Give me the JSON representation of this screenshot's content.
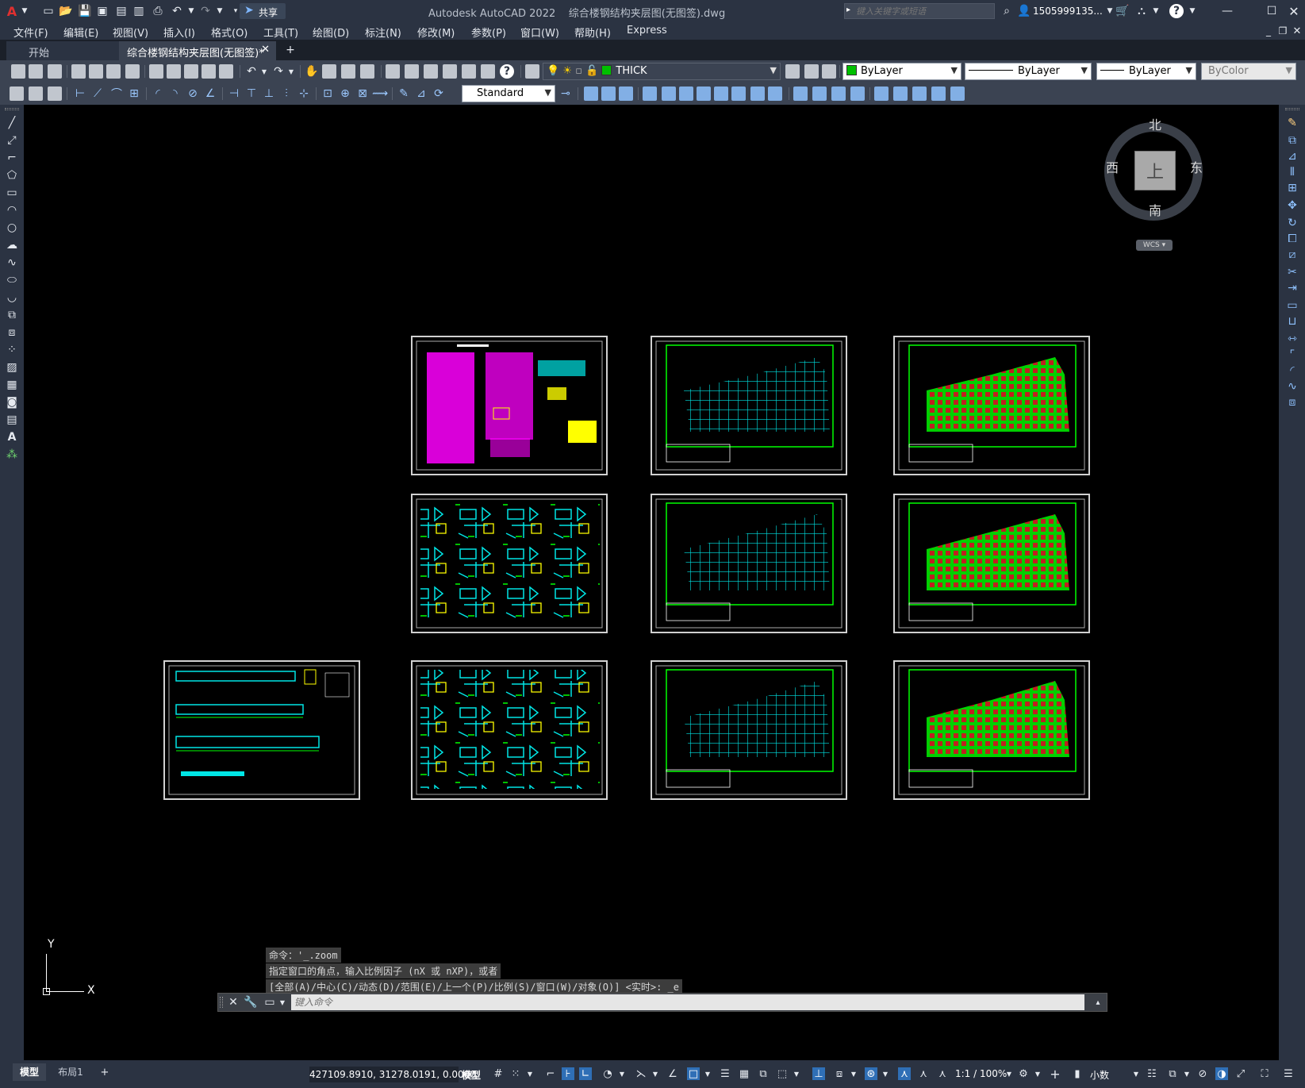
{
  "window": {
    "title": "Autodesk AutoCAD 2022",
    "document": "综合楼钢结构夹层图(无图签).dwg",
    "search_placeholder": "键入关键字或短语",
    "user": "1505999135..."
  },
  "quick_access": {
    "share_label": "共享"
  },
  "menu": [
    "文件(F)",
    "编辑(E)",
    "视图(V)",
    "插入(I)",
    "格式(O)",
    "工具(T)",
    "绘图(D)",
    "标注(N)",
    "修改(M)",
    "参数(P)",
    "窗口(W)",
    "帮助(H)",
    "Express"
  ],
  "tabs": {
    "start": "开始",
    "active": "综合楼钢结构夹层图(无图签)*"
  },
  "properties": {
    "layer": "THICK",
    "layer_color": "#00c000",
    "color": "ByLayer",
    "linetype": "ByLayer",
    "lineweight": "ByLayer",
    "plotstyle": "ByColor",
    "textstyle": "Standard"
  },
  "viewcube": {
    "north": "北",
    "south": "南",
    "east": "东",
    "west": "西",
    "top": "上",
    "ucs": "WCS"
  },
  "ucs_icon": {
    "x": "X",
    "y": "Y"
  },
  "command": {
    "history": [
      "命令：'_.zoom",
      "指定窗口的角点，输入比例因子 (nX 或 nXP)，或者",
      "[全部(A)/中心(C)/动态(D)/范围(E)/上一个(P)/比例(S)/窗口(W)/对象(O)] <实时>: _e"
    ],
    "placeholder": "键入命令"
  },
  "status": {
    "tab_model": "模型",
    "tab_layout": "布局1",
    "coords": "427109.8910, 31278.0191, 0.0000",
    "mode": "模型",
    "scale": "1:1 / 100%",
    "units": "小数"
  },
  "colors": {
    "cyan": "#00e5e5",
    "green": "#00ff00",
    "magenta": "#ff00ff",
    "yellow": "#ffff00",
    "red": "#e02020",
    "white": "#ffffff"
  }
}
